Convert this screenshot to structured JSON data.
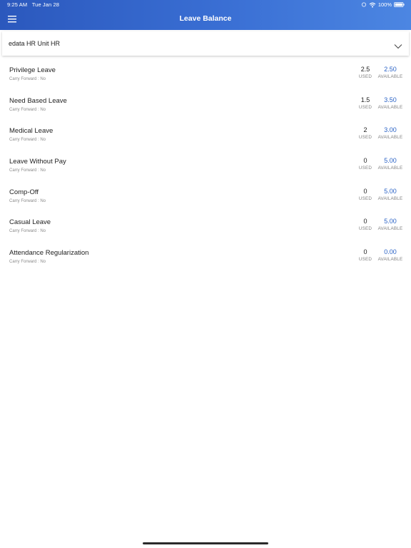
{
  "status_bar": {
    "time": "9:25 AM",
    "date": "Tue Jan 28",
    "battery": "100%",
    "icons": [
      "signal-icon",
      "wifi-icon",
      "battery-icon"
    ]
  },
  "nav": {
    "title": "Leave Balance",
    "menu_icon": "hamburger-menu-icon"
  },
  "unit_select": {
    "value": "edata HR Unit HR",
    "icon": "chevron-down-icon"
  },
  "labels": {
    "used": "USED",
    "available": "AVAILABLE"
  },
  "leaves": [
    {
      "name": "Privilege Leave",
      "carry_forward": "Carry Forward : No",
      "used": "2.5",
      "available": "2.50"
    },
    {
      "name": "Need Based Leave",
      "carry_forward": "Carry Forward : No",
      "used": "1.5",
      "available": "3.50"
    },
    {
      "name": "Medical Leave",
      "carry_forward": "Carry Forward : No",
      "used": "2",
      "available": "3.00"
    },
    {
      "name": "Leave Without Pay",
      "carry_forward": "Carry Forward : No",
      "used": "0",
      "available": "5.00"
    },
    {
      "name": "Comp-Off",
      "carry_forward": "Carry Forward : No",
      "used": "0",
      "available": "5.00"
    },
    {
      "name": "Casual Leave",
      "carry_forward": "Carry Forward : No",
      "used": "0",
      "available": "5.00"
    },
    {
      "name": "Attendance Regularization",
      "carry_forward": "Carry Forward : No",
      "used": "0",
      "available": "0.00"
    }
  ],
  "colors": {
    "header_start": "#2b58bd",
    "header_end": "#4c86e2",
    "available_value": "#2b63c6"
  }
}
